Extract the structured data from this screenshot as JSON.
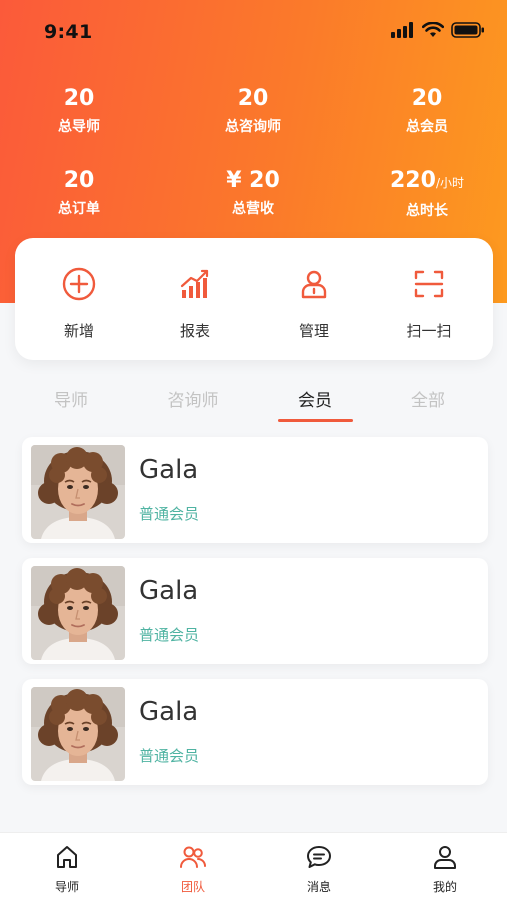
{
  "status_bar": {
    "time": "9:41"
  },
  "stats": [
    {
      "value": "20",
      "unit": "",
      "label": "总导师"
    },
    {
      "value": "20",
      "unit": "",
      "label": "总咨询师"
    },
    {
      "value": "20",
      "unit": "",
      "label": "总会员"
    },
    {
      "value": "20",
      "unit": "",
      "label": "总订单"
    },
    {
      "value": "¥ 20",
      "unit": "",
      "label": "总营收"
    },
    {
      "value": "220",
      "unit": "/小时",
      "label": "总时长"
    }
  ],
  "actions": [
    {
      "label": "新增",
      "icon": "plus-circle-icon"
    },
    {
      "label": "报表",
      "icon": "chart-icon"
    },
    {
      "label": "管理",
      "icon": "user-manage-icon"
    },
    {
      "label": "扫一扫",
      "icon": "scan-icon"
    }
  ],
  "tabs": [
    {
      "label": "导师",
      "active": false
    },
    {
      "label": "咨询师",
      "active": false
    },
    {
      "label": "会员",
      "active": true
    },
    {
      "label": "全部",
      "active": false
    }
  ],
  "members": [
    {
      "name": "Gala",
      "tag": "普通会员"
    },
    {
      "name": "Gala",
      "tag": "普通会员"
    },
    {
      "name": "Gala",
      "tag": "普通会员"
    }
  ],
  "bottom_nav": [
    {
      "label": "导师",
      "icon": "home-icon",
      "active": false
    },
    {
      "label": "团队",
      "icon": "team-icon",
      "active": true
    },
    {
      "label": "消息",
      "icon": "message-icon",
      "active": false
    },
    {
      "label": "我的",
      "icon": "profile-icon",
      "active": false
    }
  ],
  "colors": {
    "accent": "#f05a3c",
    "gradient_start": "#fb5a3a",
    "gradient_end": "#fd9a1f",
    "tag": "#4fb3a2"
  }
}
